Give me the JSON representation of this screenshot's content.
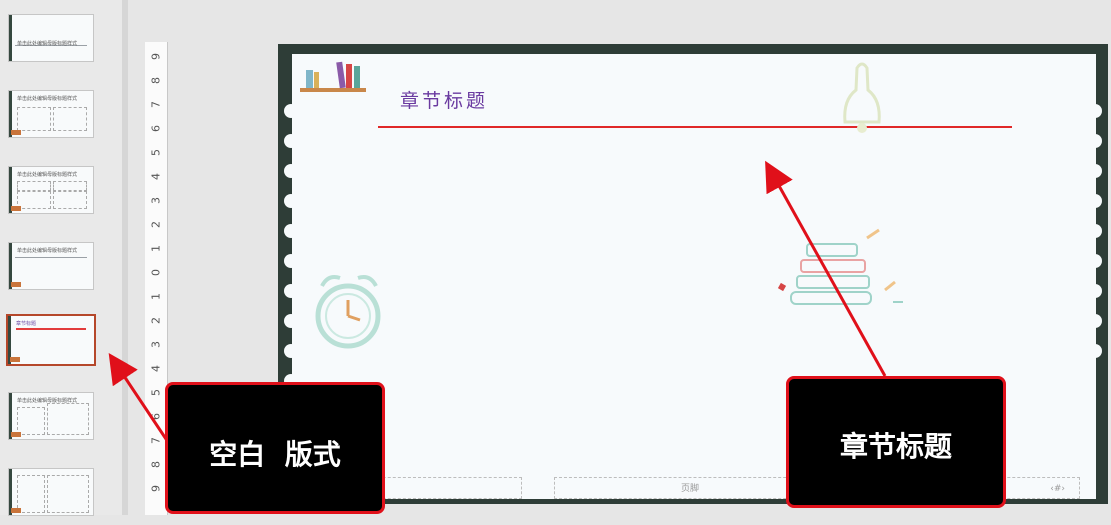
{
  "thumbnails": [
    {
      "title": "单击此处编辑母版标题样式",
      "layout": "title"
    },
    {
      "title": "单击此处编辑母版标题样式",
      "layout": "two-content"
    },
    {
      "title": "单击此处编辑母版标题样式",
      "layout": "comparison"
    },
    {
      "title": "单击此处编辑母版标题样式",
      "layout": "title-only"
    },
    {
      "title": "章节标题",
      "layout": "section-header",
      "selected": true
    },
    {
      "title": "单击此处编辑母版标题样式",
      "layout": "content-caption"
    },
    {
      "title": "",
      "layout": "picture-caption"
    }
  ],
  "ruler": {
    "numbers": [
      "9",
      "8",
      "7",
      "6",
      "5",
      "4",
      "3",
      "2",
      "1",
      "0",
      "1",
      "2",
      "3",
      "4",
      "5",
      "6",
      "7",
      "8",
      "9"
    ]
  },
  "slide": {
    "title": "章节标题",
    "footer": "页脚",
    "page_number": "‹#›",
    "frame_color": "#2e3d37",
    "accent_line_color": "#e02828",
    "title_color": "#6a3aa0"
  },
  "annotations": {
    "layout_label": "空白  版式",
    "section_label": "章节标题",
    "arrow_color": "#e0101a"
  }
}
